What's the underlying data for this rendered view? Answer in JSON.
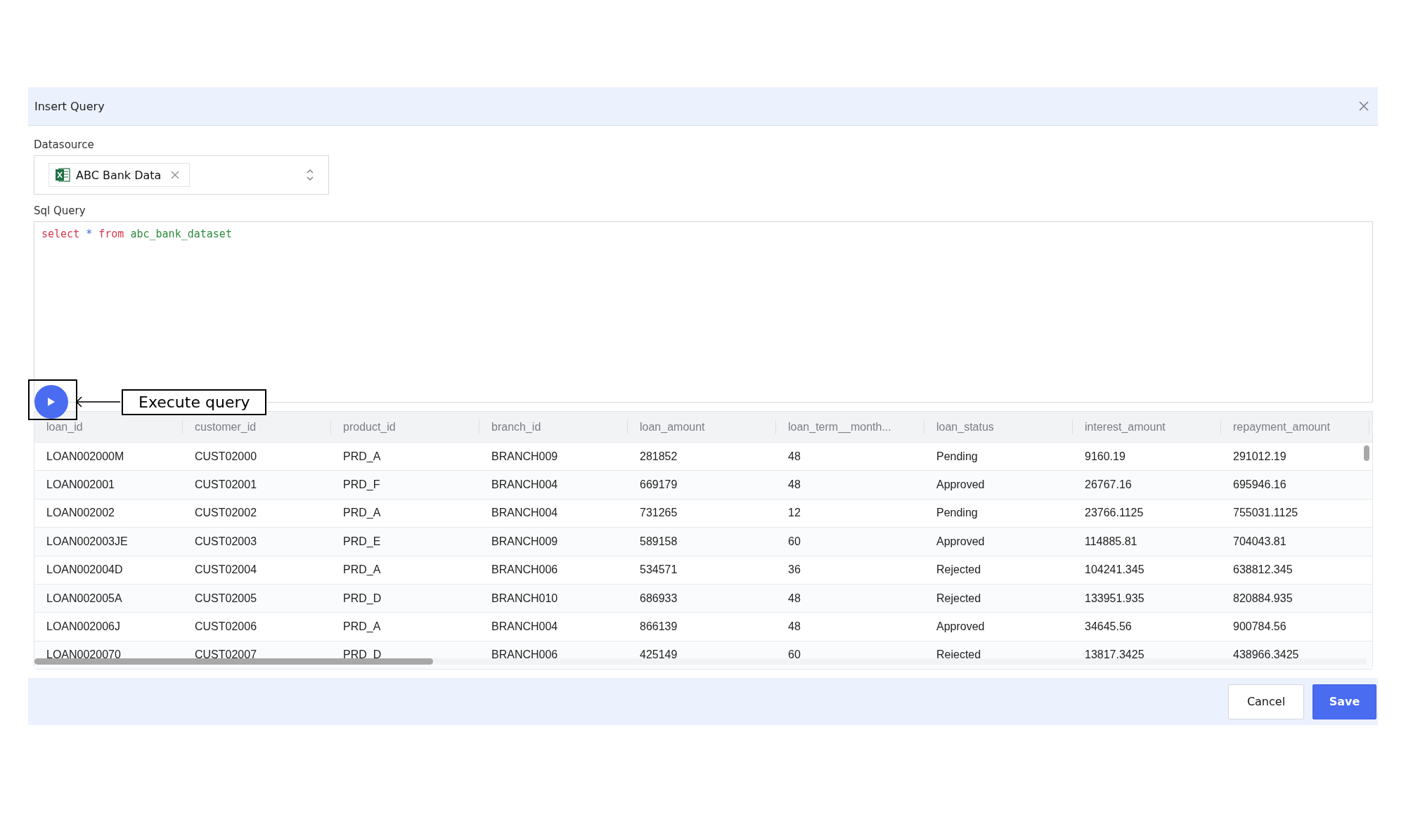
{
  "dialog": {
    "title": "Insert Query"
  },
  "datasource": {
    "label": "Datasource",
    "chip": {
      "label": "ABC Bank Data"
    }
  },
  "query": {
    "label": "Sql Query",
    "tokens": [
      {
        "text": "select",
        "kind": "keyword"
      },
      {
        "text": "*",
        "kind": "operator"
      },
      {
        "text": "from",
        "kind": "keyword"
      },
      {
        "text": "abc_bank_dataset",
        "kind": "identifier"
      }
    ]
  },
  "callout": {
    "label": "Execute query"
  },
  "table": {
    "columns": [
      "loan_id",
      "customer_id",
      "product_id",
      "branch_id",
      "loan_amount",
      "loan_term__month...",
      "loan_status",
      "interest_amount",
      "repayment_amount"
    ],
    "rows": [
      [
        "LOAN002000M",
        "CUST02000",
        "PRD_A",
        "BRANCH009",
        "281852",
        "48",
        "Pending",
        "9160.19",
        "291012.19"
      ],
      [
        "LOAN002001",
        "CUST02001",
        "PRD_F",
        "BRANCH004",
        "669179",
        "48",
        "Approved",
        "26767.16",
        "695946.16"
      ],
      [
        "LOAN002002",
        "CUST02002",
        "PRD_A",
        "BRANCH004",
        "731265",
        "12",
        "Pending",
        "23766.1125",
        "755031.1125"
      ],
      [
        "LOAN002003JE",
        "CUST02003",
        "PRD_E",
        "BRANCH009",
        "589158",
        "60",
        "Approved",
        "114885.81",
        "704043.81"
      ],
      [
        "LOAN002004D",
        "CUST02004",
        "PRD_A",
        "BRANCH006",
        "534571",
        "36",
        "Rejected",
        "104241.345",
        "638812.345"
      ],
      [
        "LOAN002005A",
        "CUST02005",
        "PRD_D",
        "BRANCH010",
        "686933",
        "48",
        "Rejected",
        "133951.935",
        "820884.935"
      ],
      [
        "LOAN002006J",
        "CUST02006",
        "PRD_A",
        "BRANCH004",
        "866139",
        "48",
        "Approved",
        "34645.56",
        "900784.56"
      ],
      [
        "LOAN0020070",
        "CUST02007",
        "PRD_D",
        "BRANCH006",
        "425149",
        "60",
        "Rejected",
        "13817.3425",
        "438966.3425"
      ]
    ]
  },
  "buttons": [
    {
      "label": "Cancel",
      "kind": "secondary"
    },
    {
      "label": "Save",
      "kind": "primary"
    }
  ]
}
